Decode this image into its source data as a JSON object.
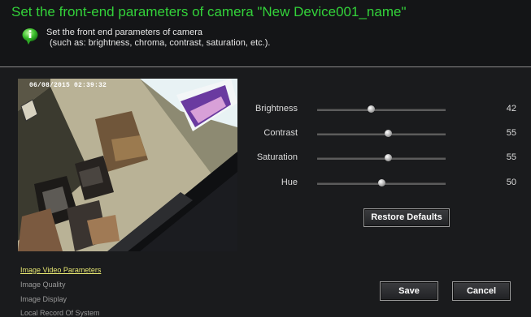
{
  "header": {
    "title": "Set the front-end parameters of camera \"New Device001_name\"",
    "description_line1": "Set the front end parameters of camera",
    "description_line2": "(such as: brightness, chroma, contrast, saturation, etc.)."
  },
  "preview": {
    "timestamp": "06/08/2015 02:39:32"
  },
  "sliders": [
    {
      "label": "Brightness",
      "value": "42",
      "level": 0.42
    },
    {
      "label": "Contrast",
      "value": "55",
      "level": 0.55
    },
    {
      "label": "Saturation",
      "value": "55",
      "level": 0.55
    },
    {
      "label": "Hue",
      "value": "50",
      "level": 0.5
    }
  ],
  "buttons": {
    "restore": "Restore Defaults",
    "save": "Save",
    "cancel": "Cancel"
  },
  "nav": {
    "items": [
      "Image Video Parameters",
      "Image Quality",
      "Image Display",
      "Local Record Of System"
    ],
    "active_index": 0
  },
  "colors": {
    "title": "#33d23a",
    "active_nav": "#e8e872"
  },
  "icons": {
    "info": "info-bubble-icon"
  }
}
